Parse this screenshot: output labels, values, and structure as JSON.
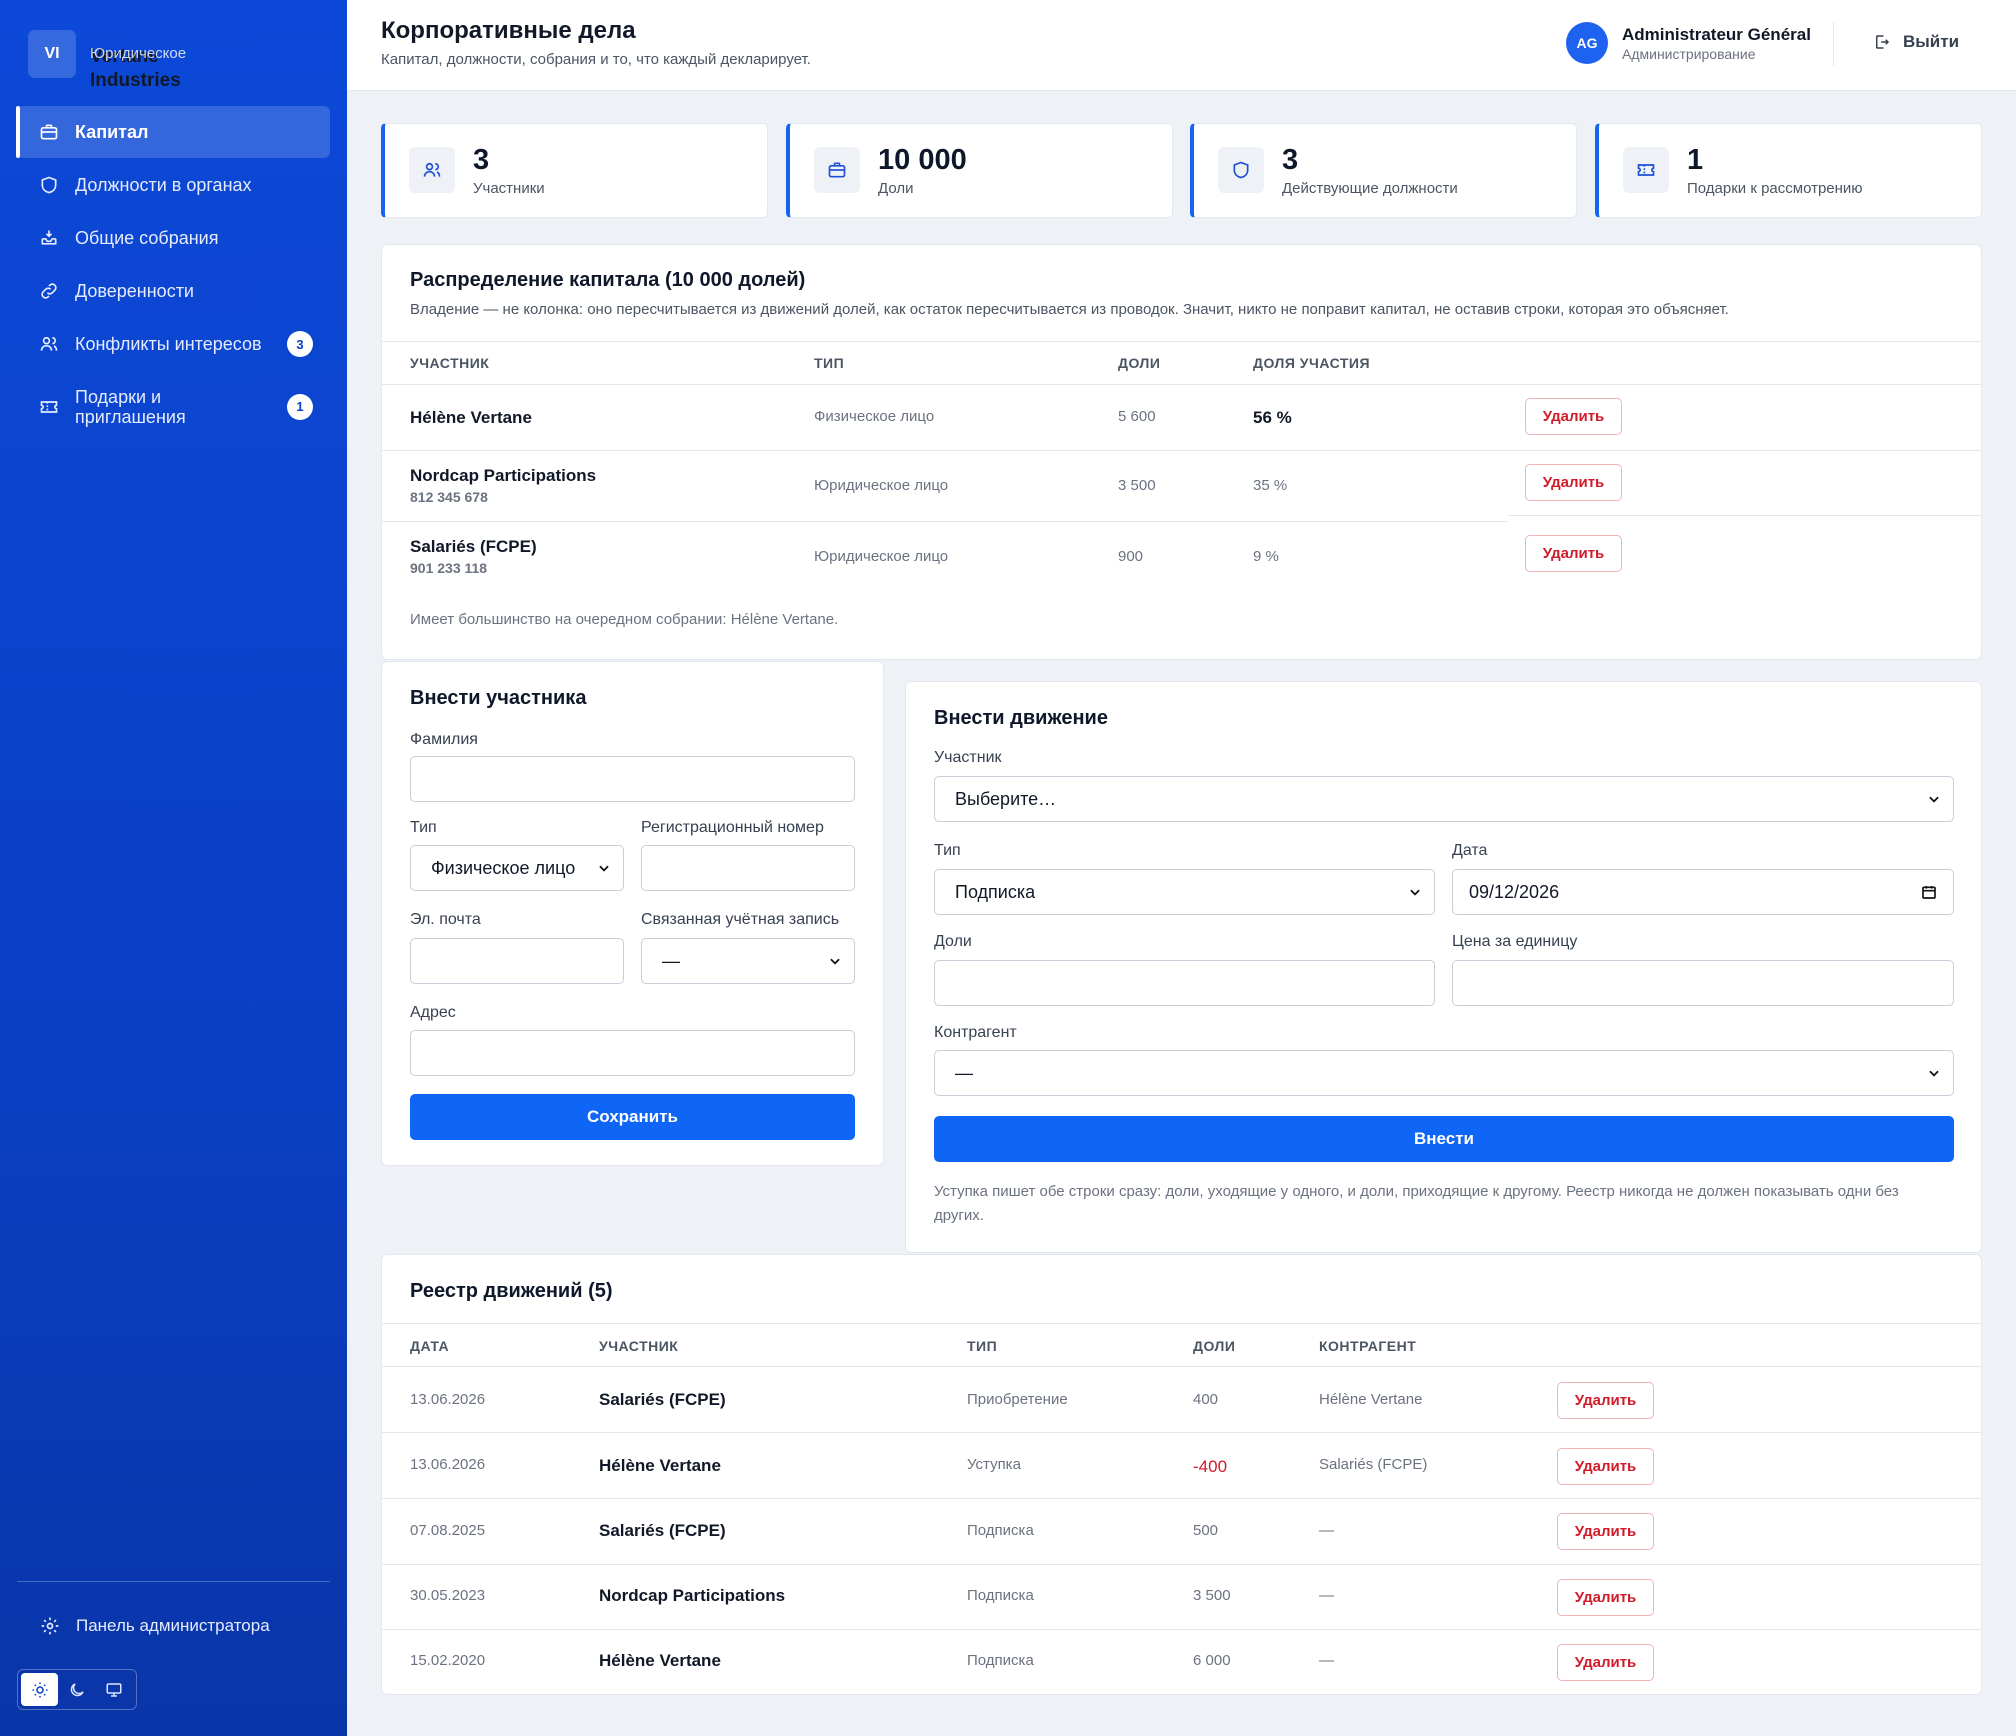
{
  "sidebar": {
    "brand_initials": "VI",
    "brand_name": "Vertane Industries",
    "brand_sub": "Юридическое",
    "items": [
      {
        "label": "Капитал",
        "icon": "briefcase-icon"
      },
      {
        "label": "Должности в органах",
        "icon": "shield-icon"
      },
      {
        "label": "Общие собрания",
        "icon": "inbox-icon"
      },
      {
        "label": "Доверенности",
        "icon": "link-icon"
      },
      {
        "label": "Конфликты интересов",
        "icon": "users-icon",
        "badge": "3"
      },
      {
        "label": "Подарки и приглашения",
        "icon": "ticket-icon",
        "badge": "1"
      }
    ],
    "admin_label": "Панель администратора"
  },
  "header": {
    "title": "Корпоративные дела",
    "subtitle": "Капитал, должности, собрания и то, что каждый декларирует.",
    "user_initials": "AG",
    "user_name": "Administrateur Général",
    "user_role": "Администрирование",
    "logout_label": "Выйти"
  },
  "stats": [
    {
      "value": "3",
      "label": "Участники",
      "icon": "users-icon"
    },
    {
      "value": "10 000",
      "label": "Доли",
      "icon": "briefcase-icon"
    },
    {
      "value": "3",
      "label": "Действующие должности",
      "icon": "shield-icon"
    },
    {
      "value": "1",
      "label": "Подарки к рассмотрению",
      "icon": "ticket-icon"
    }
  ],
  "distribution": {
    "title": "Распределение капитала (10 000 долей)",
    "desc": "Владение — не колонка: оно пересчитывается из движений долей, как остаток пересчитывается из проводок. Значит, никто не поправит капитал, не оставив строки, которая это объясняет.",
    "headers": [
      "УЧАСТНИК",
      "ТИП",
      "ДОЛИ",
      "ДОЛЯ УЧАСТИЯ"
    ],
    "rows": [
      {
        "name": "Hélène Vertane",
        "reg": "",
        "type": "Физическое лицо",
        "shares": "5 600",
        "pct": "56 %"
      },
      {
        "name": "Nordcap Participations",
        "reg": "812 345 678",
        "type": "Юридическое лицо",
        "shares": "3 500",
        "pct": "35 %"
      },
      {
        "name": "Salariés (FCPE)",
        "reg": "901 233 118",
        "type": "Юридическое лицо",
        "shares": "900",
        "pct": "9 %"
      }
    ],
    "delete_label": "Удалить",
    "footer": "Имеет большинство на очередном собрании: Hélène Vertane."
  },
  "participant_form": {
    "title": "Внести участника",
    "surname_label": "Фамилия",
    "surname_value": "",
    "type_label": "Тип",
    "type_value": "Физическое лицо",
    "reg_label": "Регистрационный номер",
    "reg_value": "",
    "email_label": "Эл. почта",
    "email_value": "",
    "account_label": "Связанная учётная запись",
    "account_value": "—",
    "address_label": "Адрес",
    "address_value": "",
    "save_label": "Сохранить"
  },
  "movement_form": {
    "title": "Внести движение",
    "participant_label": "Участник",
    "participant_value": "Выберите…",
    "type_label": "Тип",
    "type_value": "Подписка",
    "date_label": "Дата",
    "date_value": "09/12/2026",
    "shares_label": "Доли",
    "shares_value": "",
    "price_label": "Цена за единицу",
    "price_value": "",
    "counterparty_label": "Контрагент",
    "counterparty_value": "—",
    "submit_label": "Внести",
    "note": "Уступка пишет обе строки сразу: доли, уходящие у одного, и доли, приходящие к другому. Реестр никогда не должен показывать одни без других."
  },
  "register": {
    "title": "Реестр движений (5)",
    "headers": [
      "ДАТА",
      "УЧАСТНИК",
      "ТИП",
      "ДОЛИ",
      "КОНТРАГЕНТ"
    ],
    "rows": [
      {
        "date": "13.06.2026",
        "participant": "Salariés (FCPE)",
        "type": "Приобретение",
        "shares": "400",
        "counterparty": "Hélène Vertane"
      },
      {
        "date": "13.06.2026",
        "participant": "Hélène Vertane",
        "type": "Уступка",
        "shares": "-400",
        "counterparty": "Salariés (FCPE)"
      },
      {
        "date": "07.08.2025",
        "participant": "Salariés (FCPE)",
        "type": "Подписка",
        "shares": "500",
        "counterparty": "—"
      },
      {
        "date": "30.05.2023",
        "participant": "Nordcap Participations",
        "type": "Подписка",
        "shares": "3 500",
        "counterparty": "—"
      },
      {
        "date": "15.02.2020",
        "participant": "Hélène Vertane",
        "type": "Подписка",
        "shares": "6 000",
        "counterparty": "—"
      }
    ],
    "delete_label": "Удалить"
  },
  "colors": {
    "sidebar": "#0c49d8",
    "primary": "#0f65f5",
    "danger": "#d01b2b",
    "negative": "#d01b2b"
  }
}
